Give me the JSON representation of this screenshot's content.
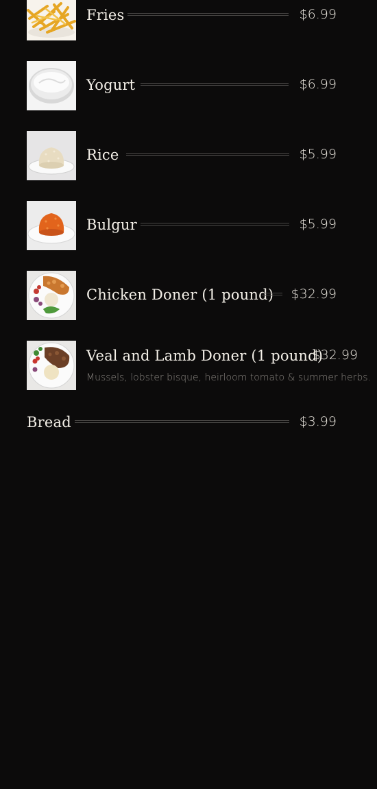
{
  "menu": {
    "items": [
      {
        "name": "Fries",
        "price": "$6.99",
        "image": "fries-photo"
      },
      {
        "name": "Yogurt",
        "price": "$6.99",
        "image": "yogurt-photo"
      },
      {
        "name": "Rice",
        "price": "$5.99",
        "image": "rice-photo"
      },
      {
        "name": "Bulgur",
        "price": "$5.99",
        "image": "bulgur-photo"
      },
      {
        "name": "Chicken Doner (1 pound)",
        "price": "$32.99",
        "image": "chicken-doner-photo"
      },
      {
        "name": "Veal and Lamb Doner (1 pound)",
        "price": "$32.99",
        "image": "veal-lamb-doner-photo",
        "description": "Mussels, lobster bisque, heirloom tomato & summer herbs."
      },
      {
        "name": "Bread",
        "price": "$3.99"
      }
    ]
  }
}
